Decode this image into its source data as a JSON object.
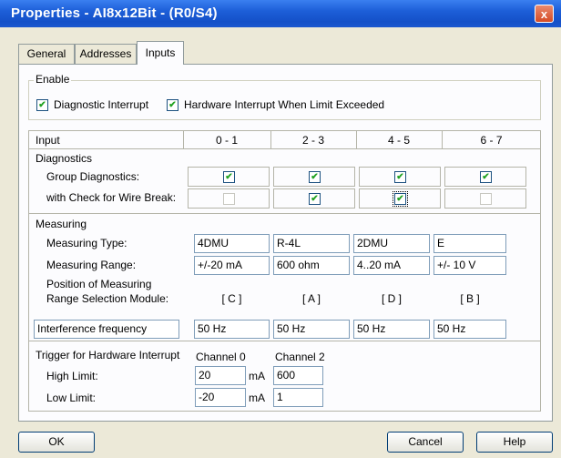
{
  "window": {
    "title": "Properties - AI8x12Bit - (R0/S4)",
    "close_label": "x"
  },
  "tabs": [
    "General",
    "Addresses",
    "Inputs"
  ],
  "enable": {
    "title": "Enable",
    "diagnostic_interrupt": {
      "label": "Diagnostic Interrupt",
      "checked": true
    },
    "hardware_interrupt": {
      "label": "Hardware Interrupt When Limit Exceeded",
      "checked": true
    }
  },
  "table": {
    "input_header": "Input",
    "channels": [
      "0 - 1",
      "2 - 3",
      "4 - 5",
      "6 - 7"
    ]
  },
  "diagnostics": {
    "title": "Diagnostics",
    "group_label": "Group Diagnostics:",
    "group_checked": [
      true,
      true,
      true,
      true
    ],
    "wirebreak_label": "with Check for Wire Break:",
    "wirebreak_checked": [
      false,
      true,
      true,
      false
    ],
    "wirebreak_enabled": [
      false,
      true,
      true,
      false
    ]
  },
  "measuring": {
    "title": "Measuring",
    "type_label": "Measuring Type:",
    "types": [
      "4DMU",
      "R-4L",
      "2DMU",
      "E"
    ],
    "range_label": "Measuring Range:",
    "ranges": [
      "+/-20 mA",
      "600 ohm",
      "4..20 mA",
      "+/- 10 V"
    ],
    "position_label_1": "Position of Measuring",
    "position_label_2": "Range Selection Module:",
    "positions": [
      "[ C ]",
      "[ A ]",
      "[ D ]",
      "[ B ]"
    ],
    "interference_label": "Interference frequency",
    "interference": [
      "50 Hz",
      "50 Hz",
      "50 Hz",
      "50 Hz"
    ]
  },
  "trigger": {
    "title": "Trigger for Hardware Interrupt",
    "channel_a": "Channel 0",
    "channel_b": "Channel 2",
    "high_label": "High Limit:",
    "high_a": "20",
    "high_b": "600",
    "low_label": "Low Limit:",
    "low_a": "-20",
    "low_b": "1",
    "unit": "mA"
  },
  "buttons": {
    "ok": "OK",
    "cancel": "Cancel",
    "help": "Help"
  }
}
